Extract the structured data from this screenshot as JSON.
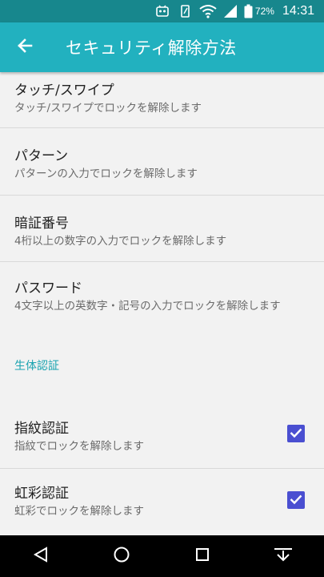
{
  "status_bar": {
    "battery_percent": "72%",
    "time": "14:31"
  },
  "app_bar": {
    "title": "セキュリティ解除方法"
  },
  "items": [
    {
      "title": "タッチ/スワイプ",
      "subtitle": "タッチ/スワイプでロックを解除します"
    },
    {
      "title": "パターン",
      "subtitle": "パターンの入力でロックを解除します"
    },
    {
      "title": "暗証番号",
      "subtitle": "4桁以上の数字の入力でロックを解除します"
    },
    {
      "title": "パスワード",
      "subtitle": "4文字以上の英数字・記号の入力でロックを解除します"
    }
  ],
  "biometrics": {
    "header": "生体認証",
    "items": [
      {
        "title": "指紋認証",
        "subtitle": "指紋でロックを解除します",
        "checked": true
      },
      {
        "title": "虹彩認証",
        "subtitle": "虹彩でロックを解除します",
        "checked": true
      }
    ]
  },
  "colors": {
    "status_bar": "#17878d",
    "app_bar": "#22b1bf",
    "accent": "#1aa3b0",
    "checkbox": "#4a4fd1"
  }
}
